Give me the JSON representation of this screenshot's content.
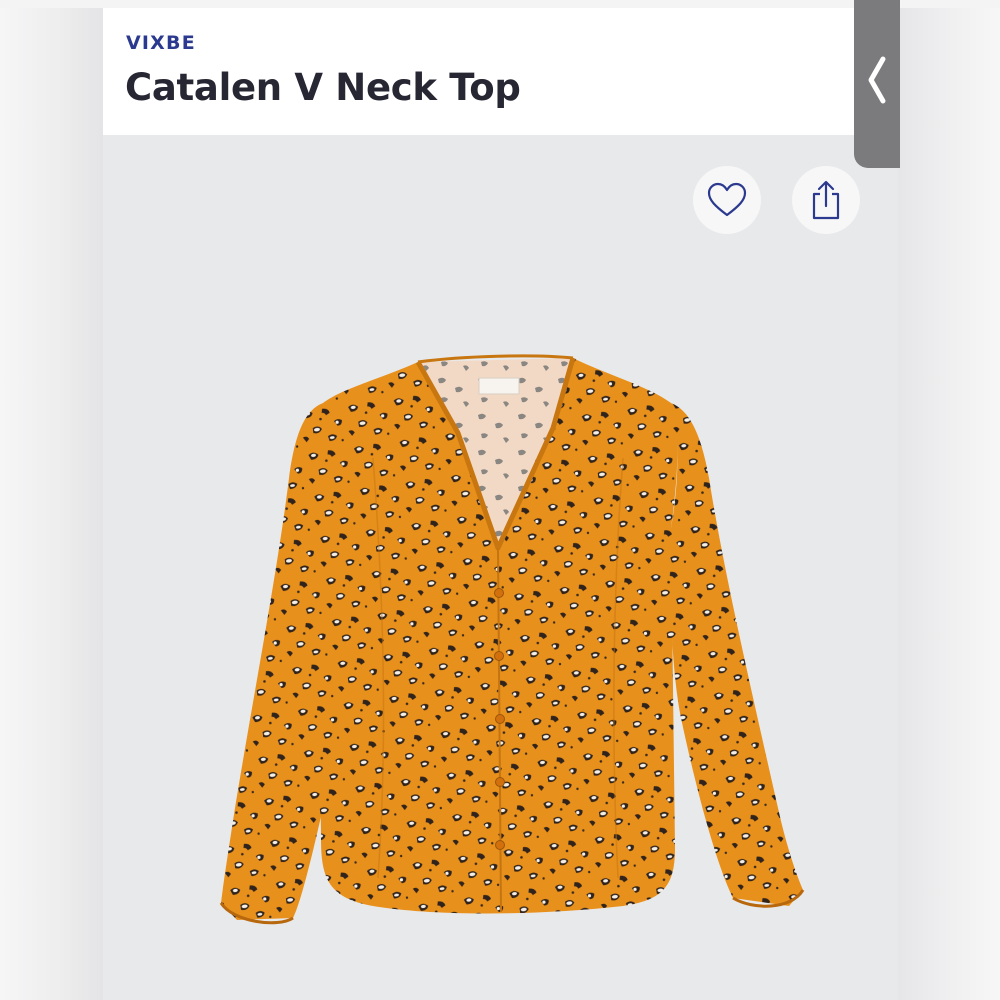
{
  "product": {
    "brand": "VIXBE",
    "name": "Catalen V Neck Top"
  },
  "icons": {
    "back": "chevron-left-icon",
    "favorite": "heart-icon",
    "share": "share-icon"
  },
  "colors": {
    "brand_text": "#2b3a8f",
    "title_text": "#262733",
    "garment": "#e8901c",
    "back_tab": "#7b7b7e"
  }
}
